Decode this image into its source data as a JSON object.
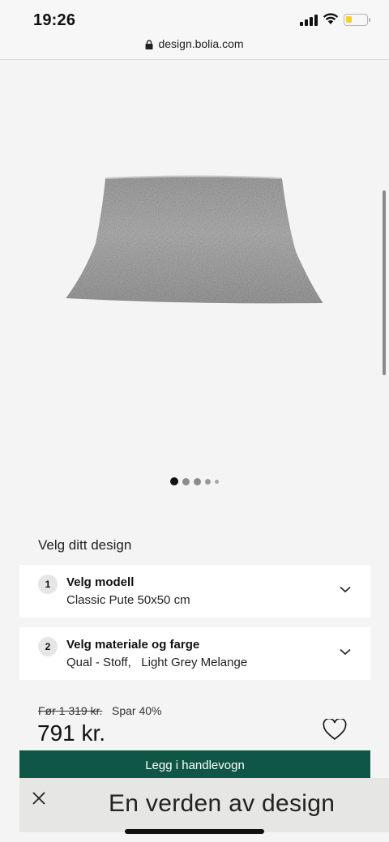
{
  "status": {
    "time": "19:26",
    "url": "design.bolia.com"
  },
  "gallery": {
    "image_name": "pillow-product-image",
    "dot_count": 5,
    "active_dot": 0
  },
  "design": {
    "title": "Velg ditt design",
    "steps": [
      {
        "number": "1",
        "title": "Velg modell",
        "value": "Classic Pute 50x50 cm"
      },
      {
        "number": "2",
        "title": "Velg materiale og farge",
        "value": "Qual - Stoff,   Light Grey Melange"
      }
    ]
  },
  "price": {
    "old": "Før 1 319 kr.",
    "save": "Spar 40%",
    "current": "791 kr."
  },
  "cart": {
    "button_label": "Legg i handlevogn"
  },
  "banner": {
    "text": "En verden av design"
  },
  "colors": {
    "cta": "#0f5646",
    "background": "#f4f4f4",
    "banner": "#e6e6e4"
  },
  "icons": [
    "lock-icon",
    "signal-icon",
    "wifi-icon",
    "battery-icon",
    "chevron-down-icon",
    "heart-icon",
    "close-icon"
  ]
}
